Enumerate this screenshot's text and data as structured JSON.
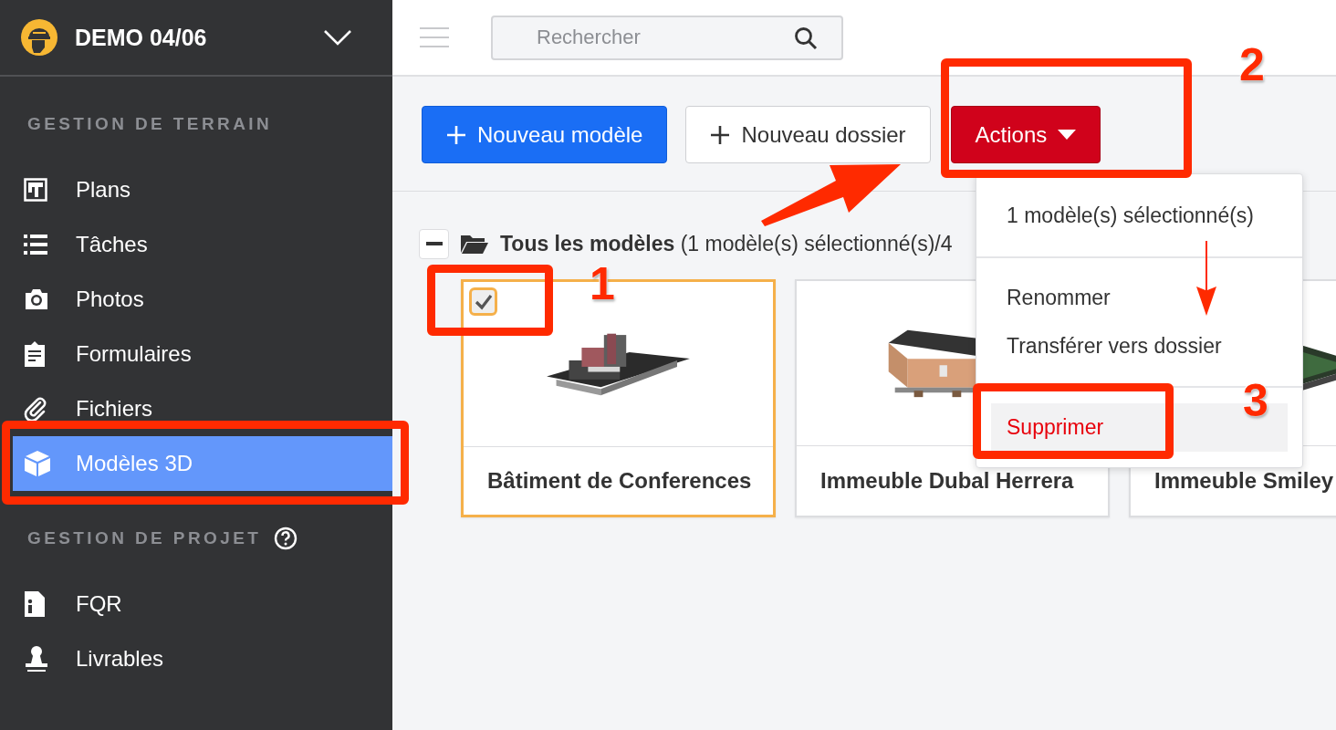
{
  "sidebar": {
    "project": "DEMO 04/06",
    "sections": [
      {
        "title": "GESTION DE TERRAIN",
        "help": false,
        "items": [
          {
            "label": "Plans",
            "selected": false
          },
          {
            "label": "Tâches",
            "selected": false
          },
          {
            "label": "Photos",
            "selected": false
          },
          {
            "label": "Formulaires",
            "selected": false
          },
          {
            "label": "Fichiers",
            "selected": false
          },
          {
            "label": "Modèles 3D",
            "selected": true
          }
        ]
      },
      {
        "title": "GESTION DE PROJET",
        "help": true,
        "items": [
          {
            "label": "FQR",
            "selected": false
          },
          {
            "label": "Livrables",
            "selected": false
          }
        ]
      }
    ]
  },
  "search": {
    "placeholder": "Rechercher"
  },
  "toolbar": {
    "buttons": [
      {
        "label": "Nouveau modèle",
        "kind": "primary"
      },
      {
        "label": "Nouveau dossier",
        "kind": "secondary"
      },
      {
        "label": "Actions",
        "kind": "danger"
      }
    ]
  },
  "breadcrumb": {
    "indeterminate": true,
    "title": "Tous les modèles",
    "detail": "(1 modèle(s) sélectionné(s)/4"
  },
  "models": [
    {
      "name": "Bâtiment de Conferences",
      "selected": true
    },
    {
      "name": "Immeuble Dubal Herrera",
      "selected": false
    },
    {
      "name": "Immeuble Smiley",
      "selected": false
    }
  ],
  "menu": {
    "header": "1 modèle(s) sélectionné(s)",
    "items": [
      {
        "label": "Renommer",
        "kind": "normal",
        "highlighted": false
      },
      {
        "label": "Transférer vers dossier",
        "kind": "normal",
        "highlighted": false
      },
      {
        "label": "Supprimer",
        "kind": "danger",
        "highlighted": true
      }
    ]
  },
  "annotations": [
    {
      "kind": "frame"
    },
    {
      "kind": "frame"
    },
    {
      "kind": "frame"
    },
    {
      "kind": "frame"
    },
    {
      "kind": "arrow"
    },
    {
      "kind": "arrow"
    },
    {
      "kind": "number",
      "label": "1"
    },
    {
      "kind": "number",
      "label": "2"
    },
    {
      "kind": "number",
      "label": "3"
    }
  ]
}
